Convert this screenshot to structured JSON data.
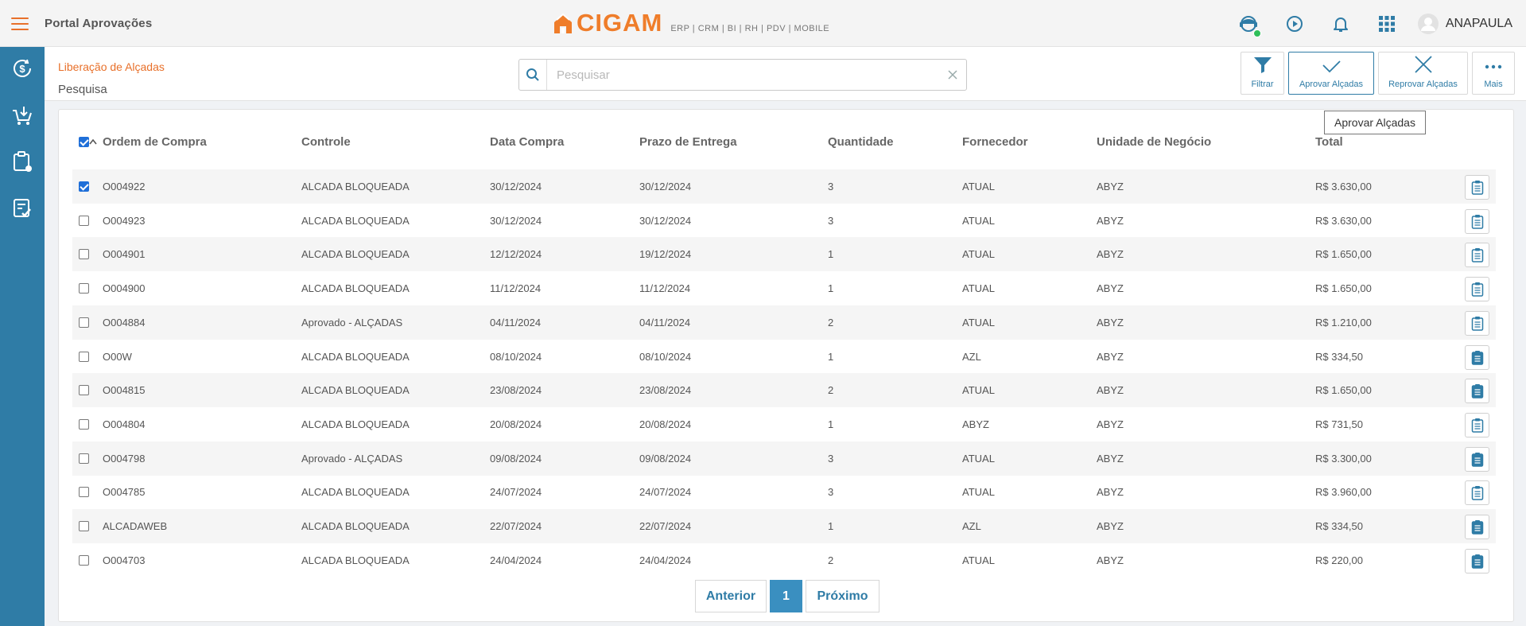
{
  "app": {
    "title": "Portal Aprovações",
    "logo_text": "CIGAM",
    "logo_sub": "ERP | CRM | BI | RH | PDV | MOBILE",
    "user": "ANAPAULA"
  },
  "colors": {
    "brand": "#ef7d2a",
    "sidebar": "#2f7ca6",
    "accent": "#3a8fc0",
    "online": "#2fbf59"
  },
  "header": {
    "breadcrumb": "Liberação de Alçadas",
    "page_title": "Pesquisa",
    "search_placeholder": "Pesquisar"
  },
  "actions": {
    "filter": "Filtrar",
    "approve": "Aprovar Alçadas",
    "reject": "Reprovar Alçadas",
    "more": "Mais"
  },
  "tooltip": "Aprovar Alçadas",
  "table": {
    "columns": [
      "Ordem de Compra",
      "Controle",
      "Data Compra",
      "Prazo de Entrega",
      "Quantidade",
      "Fornecedor",
      "Unidade de Negócio",
      "Total"
    ],
    "rows": [
      {
        "checked": true,
        "ordem": "O004922",
        "controle": "ALCADA BLOQUEADA",
        "data": "30/12/2024",
        "prazo": "30/12/2024",
        "qtd": "3",
        "fornecedor": "ATUAL",
        "unidade": "ABYZ",
        "total": "R$ 3.630,00",
        "doc_filled": false
      },
      {
        "checked": false,
        "ordem": "O004923",
        "controle": "ALCADA BLOQUEADA",
        "data": "30/12/2024",
        "prazo": "30/12/2024",
        "qtd": "3",
        "fornecedor": "ATUAL",
        "unidade": "ABYZ",
        "total": "R$ 3.630,00",
        "doc_filled": false
      },
      {
        "checked": false,
        "ordem": "O004901",
        "controle": "ALCADA BLOQUEADA",
        "data": "12/12/2024",
        "prazo": "19/12/2024",
        "qtd": "1",
        "fornecedor": "ATUAL",
        "unidade": "ABYZ",
        "total": "R$ 1.650,00",
        "doc_filled": false
      },
      {
        "checked": false,
        "ordem": "O004900",
        "controle": "ALCADA BLOQUEADA",
        "data": "11/12/2024",
        "prazo": "11/12/2024",
        "qtd": "1",
        "fornecedor": "ATUAL",
        "unidade": "ABYZ",
        "total": "R$ 1.650,00",
        "doc_filled": false
      },
      {
        "checked": false,
        "ordem": "O004884",
        "controle": "Aprovado - ALÇADAS",
        "data": "04/11/2024",
        "prazo": "04/11/2024",
        "qtd": "2",
        "fornecedor": "ATUAL",
        "unidade": "ABYZ",
        "total": "R$ 1.210,00",
        "doc_filled": false
      },
      {
        "checked": false,
        "ordem": "O00W",
        "controle": "ALCADA BLOQUEADA",
        "data": "08/10/2024",
        "prazo": "08/10/2024",
        "qtd": "1",
        "fornecedor": "AZL",
        "unidade": "ABYZ",
        "total": "R$ 334,50",
        "doc_filled": true
      },
      {
        "checked": false,
        "ordem": "O004815",
        "controle": "ALCADA BLOQUEADA",
        "data": "23/08/2024",
        "prazo": "23/08/2024",
        "qtd": "2",
        "fornecedor": "ATUAL",
        "unidade": "ABYZ",
        "total": "R$ 1.650,00",
        "doc_filled": true
      },
      {
        "checked": false,
        "ordem": "O004804",
        "controle": "ALCADA BLOQUEADA",
        "data": "20/08/2024",
        "prazo": "20/08/2024",
        "qtd": "1",
        "fornecedor": "ABYZ",
        "unidade": "ABYZ",
        "total": "R$ 731,50",
        "doc_filled": false
      },
      {
        "checked": false,
        "ordem": "O004798",
        "controle": "Aprovado - ALÇADAS",
        "data": "09/08/2024",
        "prazo": "09/08/2024",
        "qtd": "3",
        "fornecedor": "ATUAL",
        "unidade": "ABYZ",
        "total": "R$ 3.300,00",
        "doc_filled": true
      },
      {
        "checked": false,
        "ordem": "O004785",
        "controle": "ALCADA BLOQUEADA",
        "data": "24/07/2024",
        "prazo": "24/07/2024",
        "qtd": "3",
        "fornecedor": "ATUAL",
        "unidade": "ABYZ",
        "total": "R$ 3.960,00",
        "doc_filled": false
      },
      {
        "checked": false,
        "ordem": "ALCADAWEB",
        "controle": "ALCADA BLOQUEADA",
        "data": "22/07/2024",
        "prazo": "22/07/2024",
        "qtd": "1",
        "fornecedor": "AZL",
        "unidade": "ABYZ",
        "total": "R$ 334,50",
        "doc_filled": true
      },
      {
        "checked": false,
        "ordem": "O004703",
        "controle": "ALCADA BLOQUEADA",
        "data": "24/04/2024",
        "prazo": "24/04/2024",
        "qtd": "2",
        "fornecedor": "ATUAL",
        "unidade": "ABYZ",
        "total": "R$ 220,00",
        "doc_filled": true
      }
    ]
  },
  "pagination": {
    "prev": "Anterior",
    "current": "1",
    "next": "Próximo"
  },
  "sidebar_icons": [
    "money-icon",
    "cart-download-icon",
    "clipboard-icon",
    "approval-list-icon"
  ]
}
